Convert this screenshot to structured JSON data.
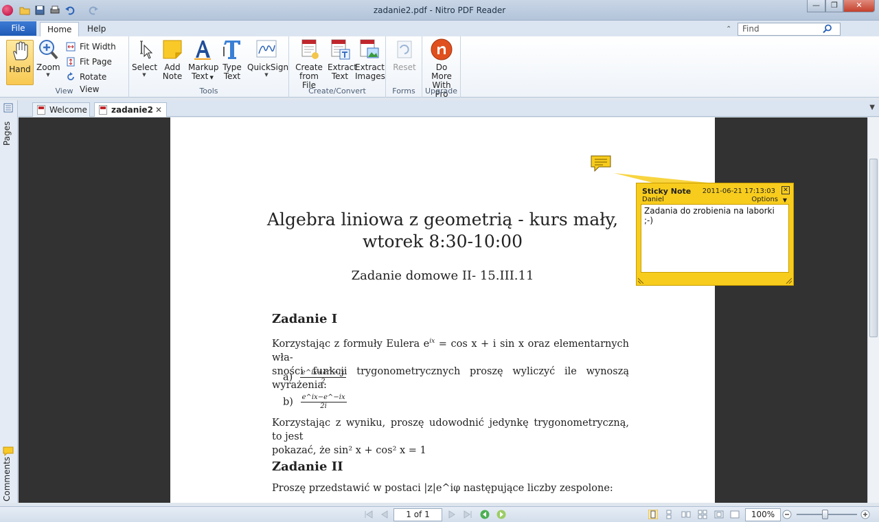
{
  "window": {
    "title": "zadanie2.pdf - Nitro PDF Reader",
    "minimize": "—",
    "maximize": "❐",
    "close": "✕"
  },
  "ribbon_tabs": {
    "file": "File",
    "home": "Home",
    "help": "Help"
  },
  "find": {
    "placeholder": "Find"
  },
  "ribbon": {
    "view": {
      "label": "View",
      "hand": "Hand",
      "zoom": "Zoom",
      "fit_width": "Fit Width",
      "fit_page": "Fit Page",
      "rotate_view": "Rotate View"
    },
    "tools": {
      "label": "Tools",
      "select": "Select",
      "add_note_1": "Add",
      "add_note_2": "Note",
      "markup_1": "Markup",
      "markup_2": "Text",
      "type_1": "Type",
      "type_2": "Text",
      "quicksign": "QuickSign"
    },
    "create_convert": {
      "label": "Create/Convert",
      "create_1": "Create",
      "create_2": "from File",
      "extract_text_1": "Extract",
      "extract_text_2": "Text",
      "extract_images_1": "Extract",
      "extract_images_2": "Images"
    },
    "forms": {
      "label": "Forms",
      "reset": "Reset"
    },
    "upgrade": {
      "label": "Upgrade",
      "more_1": "Do More",
      "more_2": "With Pro"
    }
  },
  "side_panels": {
    "pages": "Pages",
    "comments": "Comments"
  },
  "document_tabs": [
    {
      "label": "Welcome"
    },
    {
      "label": "zadanie2"
    }
  ],
  "document": {
    "title_line1": "Algebra liniowa z geometrią - kurs mały,",
    "title_line2": "wtorek 8:30-10:00",
    "subtitle": "Zadanie domowe II- 15.III.11",
    "section1": "Zadanie I",
    "para1_line1": "Korzystając z formuły Eulera e",
    "para1_sup": "ix",
    "para1_rest": " = cos x + i sin x oraz elementarnych wła-",
    "para1_line2": "sności funkcji trygonometrycznych proszę wyliczyć ile wynoszą wyrażenia:",
    "item_a": "a)",
    "item_a_num": "e^ix+e^−ix",
    "item_a_den": "2",
    "item_b": "b)",
    "item_b_num": "e^ix−e^−ix",
    "item_b_den": "2i",
    "para2_line1": "Korzystając z wyniku, proszę udowodnić jedynkę trygonometryczną, to jest",
    "para2_line2": "pokazać, że sin² x + cos² x = 1",
    "section2": "Zadanie II",
    "para3": "Proszę przedstawić w postaci |z|e^iφ następujące liczby zespolone:"
  },
  "sticky_note": {
    "title": "Sticky Note",
    "date": "2011-06-21 17:13:03",
    "author": "Daniel",
    "options": "Options",
    "text": "Zadania do zrobienia na laborki ;-)"
  },
  "statusbar": {
    "page": "1 of 1",
    "zoom": "100%"
  },
  "colors": {
    "sticky": "#f7cc1d",
    "file_tab": "#1f5bb8",
    "viewer_bg": "#323232"
  }
}
